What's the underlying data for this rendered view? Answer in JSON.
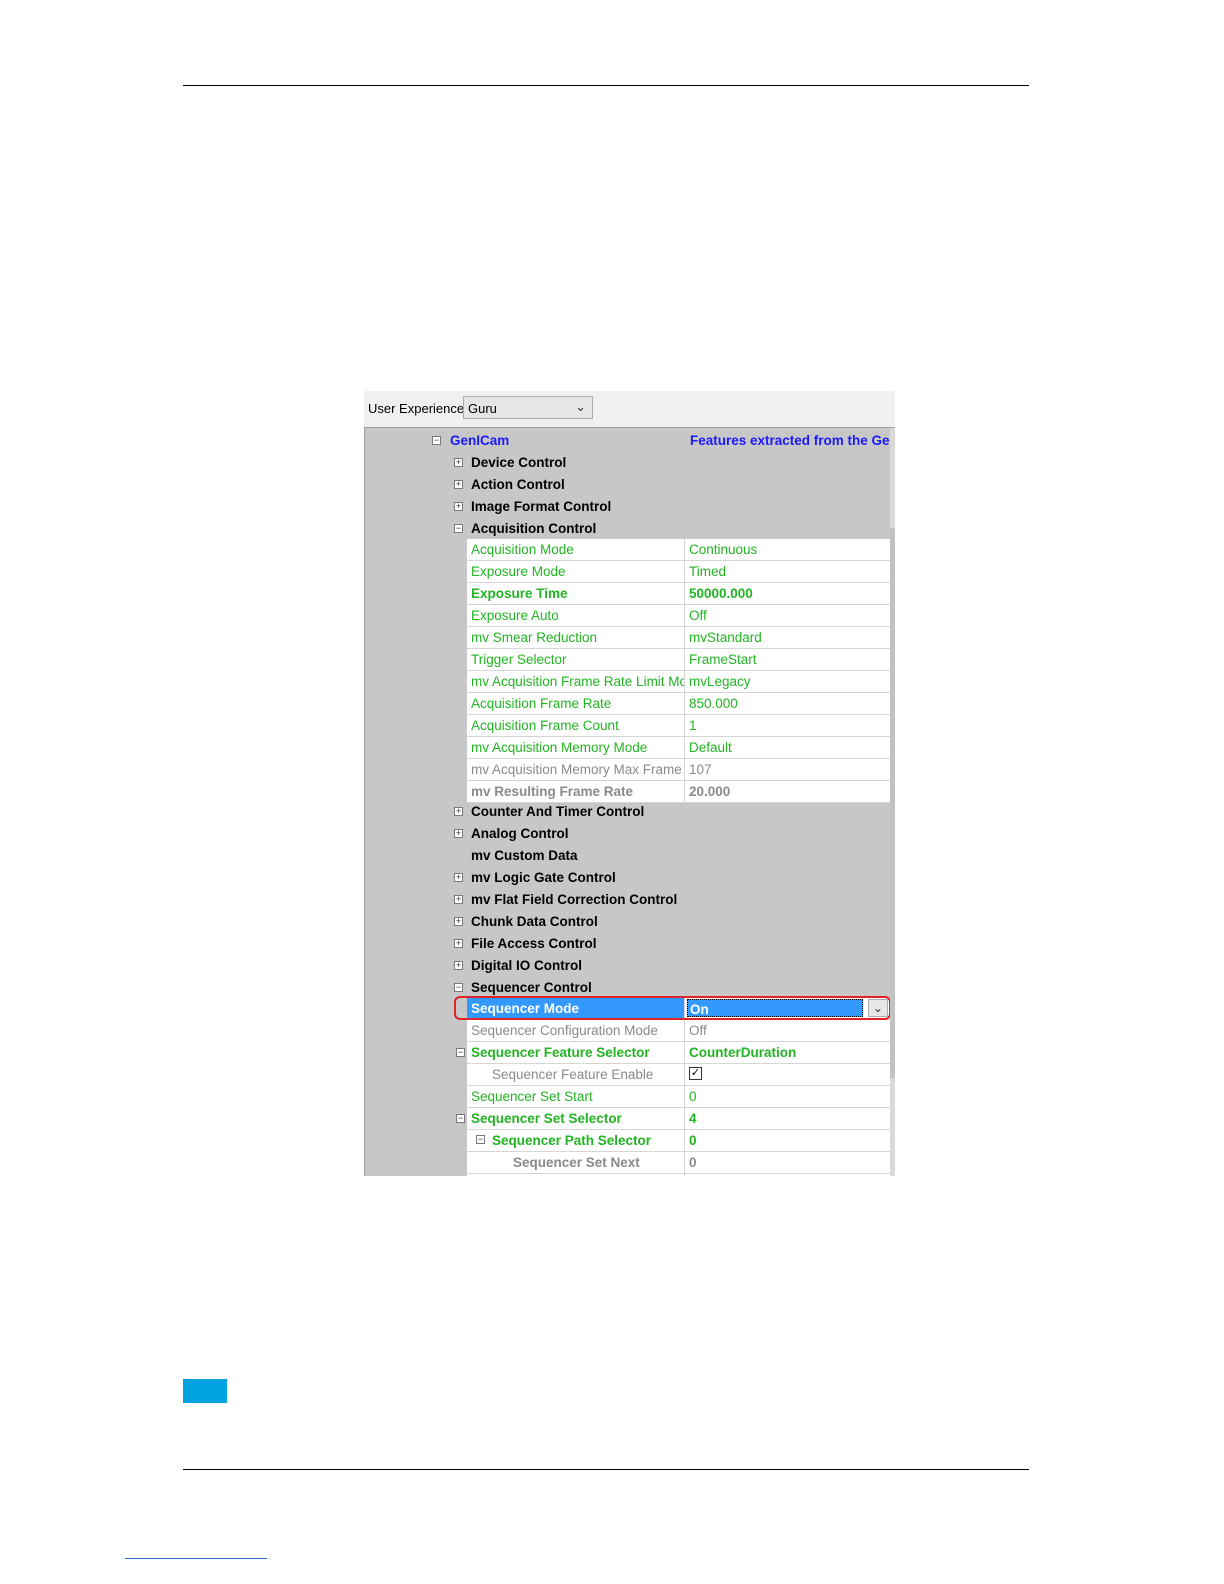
{
  "ux": {
    "label": "User Experience:",
    "value": "Guru"
  },
  "genicam": {
    "label": "GenICam",
    "desc": "Features extracted from the Ger"
  },
  "categories_top": [
    "Device Control",
    "Action Control",
    "Image Format Control",
    "Acquisition Control"
  ],
  "acquisition": [
    {
      "name": "Acquisition Mode",
      "value": "Continuous"
    },
    {
      "name": "Exposure Mode",
      "value": "Timed"
    },
    {
      "name": "Exposure Time",
      "value": "50000.000"
    },
    {
      "name": "Exposure Auto",
      "value": "Off"
    },
    {
      "name": "mv Smear Reduction",
      "value": "mvStandard"
    },
    {
      "name": "Trigger Selector",
      "value": "FrameStart"
    },
    {
      "name": "mv Acquisition Frame Rate Limit Mod",
      "value": "mvLegacy"
    },
    {
      "name": "Acquisition Frame Rate",
      "value": "850.000"
    },
    {
      "name": "Acquisition Frame Count",
      "value": "1"
    },
    {
      "name": "mv Acquisition Memory Mode",
      "value": "Default"
    },
    {
      "name": "mv Acquisition Memory Max Frame C",
      "value": "107"
    },
    {
      "name": "mv Resulting Frame Rate",
      "value": "20.000"
    }
  ],
  "categories_mid": [
    "Counter And Timer Control",
    "Analog Control",
    "mv Custom Data",
    "mv Logic Gate Control",
    "mv Flat Field Correction Control",
    "Chunk Data Control",
    "File Access Control",
    "Digital IO Control",
    "Sequencer Control"
  ],
  "sequencer": [
    {
      "name": "Sequencer Mode",
      "value": "On"
    },
    {
      "name": "Sequencer Configuration Mode",
      "value": "Off"
    },
    {
      "name": "Sequencer Feature Selector",
      "value": "CounterDuration"
    },
    {
      "name": "Sequencer Feature Enable",
      "value": "checked"
    },
    {
      "name": "Sequencer Set Start",
      "value": "0"
    },
    {
      "name": "Sequencer Set Selector",
      "value": "4"
    },
    {
      "name": "Sequencer Path Selector",
      "value": "0"
    },
    {
      "name": "Sequencer Set Next",
      "value": "0"
    }
  ]
}
